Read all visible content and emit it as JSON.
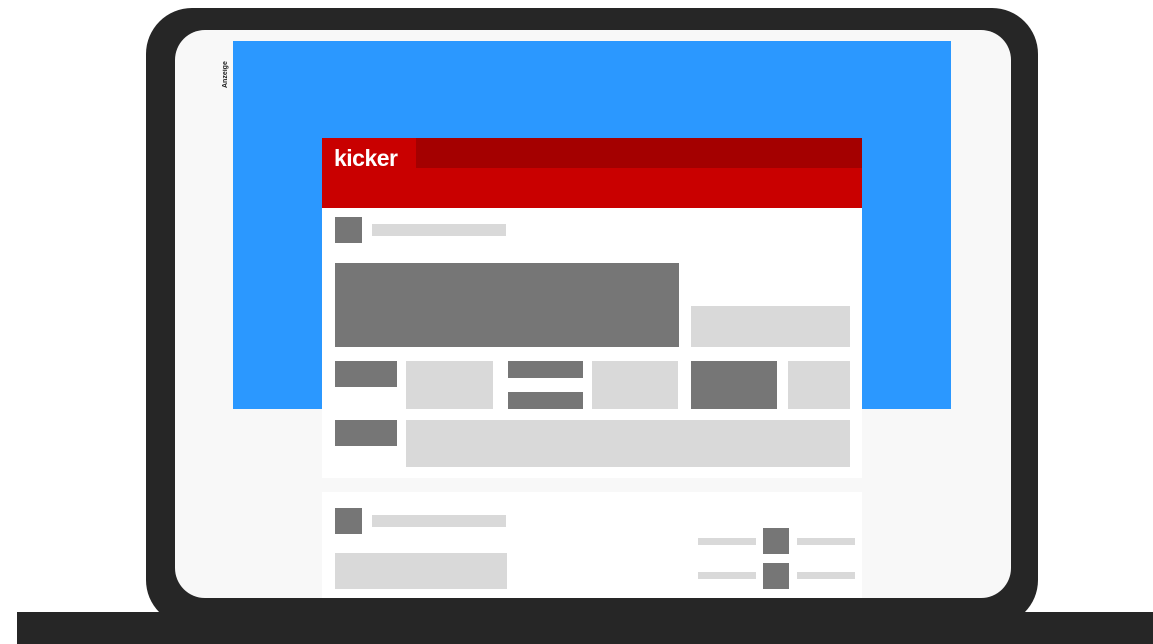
{
  "ad": {
    "label": "Anzeige"
  },
  "site": {
    "logo_text": "kicker"
  },
  "colors": {
    "ad_background": "#2b98ff",
    "header_red": "#c90000",
    "header_dark_red": "#a40000",
    "frame": "#262626",
    "placeholder_dark": "#767676",
    "placeholder_light": "#d9d9d9"
  }
}
